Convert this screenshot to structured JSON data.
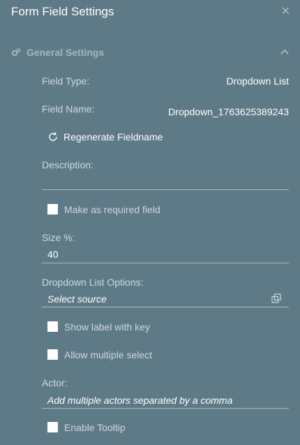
{
  "window": {
    "title": "Form Field Settings",
    "close_icon": "close-icon"
  },
  "section": {
    "title": "General Settings",
    "icon": "gears-icon",
    "toggle_icon": "chevron-up-icon"
  },
  "fields": {
    "field_type_label": "Field Type:",
    "field_type_value": "Dropdown List",
    "field_name_label": "Field Name:",
    "field_name_value": "Dropdown_1763625389243",
    "regenerate_label": "Regenerate Fieldname",
    "description_label": "Description:",
    "description_value": "",
    "required_label": "Make as required field",
    "size_label": "Size %:",
    "size_value": "40",
    "options_label": "Dropdown List Options:",
    "options_placeholder": "Select source",
    "show_label_key": "Show label with key",
    "allow_multiple": "Allow multiple select",
    "actor_label": "Actor:",
    "actor_placeholder": "Add multiple actors separated by a comma",
    "tooltip_label": "Enable Tooltip"
  },
  "colors": {
    "background": "#5f7a87",
    "text": "#ffffff",
    "muted": "#ccd8de",
    "section_title": "#a3b6bf"
  }
}
